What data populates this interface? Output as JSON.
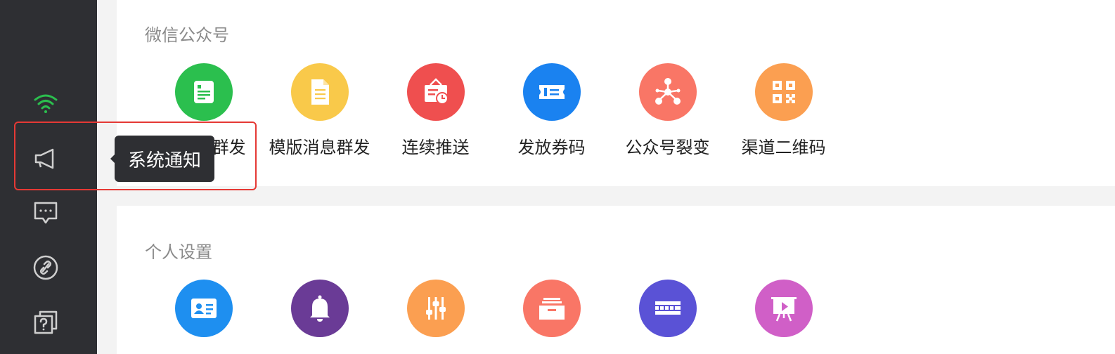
{
  "sidebar": {
    "items": [
      {
        "icon": "wifi-icon",
        "color": "#2bbf4e"
      },
      {
        "icon": "megaphone-icon",
        "color": "#cfcfcf"
      },
      {
        "icon": "chat-bubble-icon",
        "color": "#cfcfcf"
      },
      {
        "icon": "link-icon",
        "color": "#cfcfcf"
      },
      {
        "icon": "help-copy-icon",
        "color": "#cfcfcf"
      }
    ]
  },
  "tooltip": {
    "text": "系统通知"
  },
  "sections": [
    {
      "title": "微信公众号",
      "features": [
        {
          "label": "公众号群发",
          "icon": "document-icon",
          "color": "#2bbf4e"
        },
        {
          "label": "模版消息群发",
          "icon": "file-icon",
          "color": "#f9c94a"
        },
        {
          "label": "连续推送",
          "icon": "schedule-board-icon",
          "color": "#ef4f4f"
        },
        {
          "label": "发放券码",
          "icon": "ticket-icon",
          "color": "#1a82f0"
        },
        {
          "label": "公众号裂变",
          "icon": "network-icon",
          "color": "#f97666"
        },
        {
          "label": "渠道二维码",
          "icon": "qrcode-icon",
          "color": "#fb9f51"
        }
      ]
    },
    {
      "title": "个人设置",
      "features": [
        {
          "icon": "id-card-icon",
          "color": "#1e8ff0"
        },
        {
          "icon": "bell-icon",
          "color": "#6a3b96"
        },
        {
          "icon": "sliders-icon",
          "color": "#fb9f51"
        },
        {
          "icon": "inbox-icon",
          "color": "#f97666"
        },
        {
          "icon": "keyboard-icon",
          "color": "#5a52d6"
        },
        {
          "icon": "presentation-icon",
          "color": "#d05fc7"
        }
      ]
    }
  ]
}
